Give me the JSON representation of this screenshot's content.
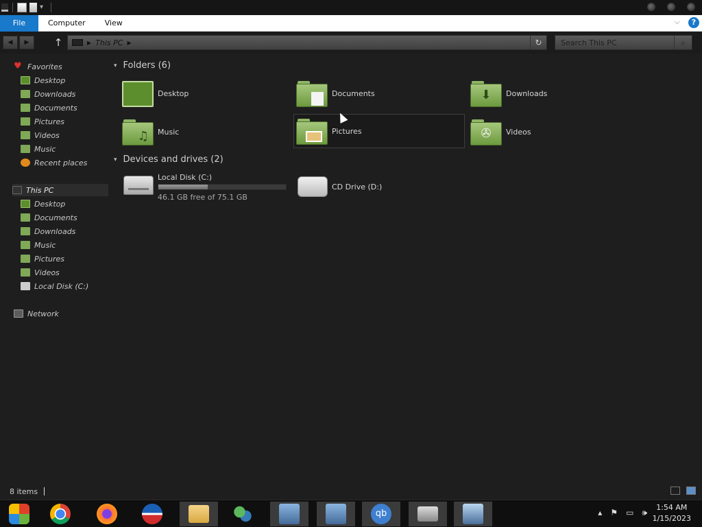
{
  "ribbon": {
    "tabs": [
      "File",
      "Computer",
      "View"
    ]
  },
  "address": {
    "crumbs": [
      "This PC"
    ]
  },
  "search": {
    "placeholder": "Search This PC"
  },
  "nav_pane": {
    "favorites_label": "Favorites",
    "favorites": [
      "Desktop",
      "Downloads",
      "Documents",
      "Pictures",
      "Videos",
      "Music",
      "Recent places"
    ],
    "this_pc_label": "This PC",
    "this_pc": [
      "Desktop",
      "Documents",
      "Downloads",
      "Music",
      "Pictures",
      "Videos",
      "Local Disk (C:)"
    ],
    "network_label": "Network"
  },
  "content": {
    "folders_header": "Folders (6)",
    "folders": [
      "Desktop",
      "Documents",
      "Downloads",
      "Music",
      "Pictures",
      "Videos"
    ],
    "devices_header": "Devices and drives (2)",
    "drives": [
      {
        "name": "Local Disk (C:)",
        "free_text": "46.1 GB free of 75.1 GB",
        "used_fraction": 0.386
      },
      {
        "name": "CD Drive (D:)"
      }
    ]
  },
  "status": {
    "items": "8 items"
  },
  "taskbar": {
    "icons": [
      "start-icon",
      "chrome-icon",
      "firefox-icon",
      "obama-logo-icon",
      "file-explorer-icon",
      "messenger-icon",
      "network-setup-icon",
      "network-setup-icon",
      "qbittorrent-icon",
      "scanner-icon",
      "remote-desktop-icon"
    ],
    "time": "1:54 AM",
    "date": "1/15/2023"
  },
  "colors": {
    "accent": "#1979ca",
    "folder_green": "#8fb665"
  }
}
